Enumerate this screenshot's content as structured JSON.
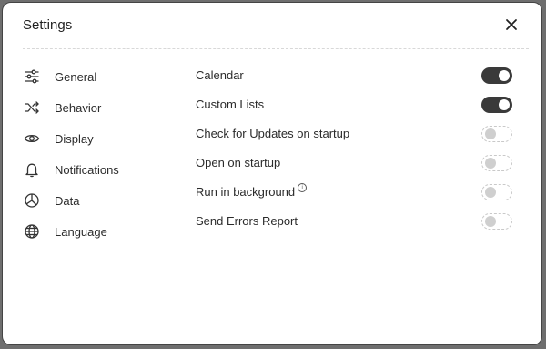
{
  "dialog": {
    "title": "Settings"
  },
  "sidebar": {
    "items": [
      {
        "label": "General",
        "icon": "sliders-icon"
      },
      {
        "label": "Behavior",
        "icon": "shuffle-icon"
      },
      {
        "label": "Display",
        "icon": "eye-icon"
      },
      {
        "label": "Notifications",
        "icon": "bell-icon"
      },
      {
        "label": "Data",
        "icon": "pie-chart-icon"
      },
      {
        "label": "Language",
        "icon": "globe-icon"
      }
    ]
  },
  "settings": {
    "rows": [
      {
        "label": "Calendar",
        "enabled": true
      },
      {
        "label": "Custom Lists",
        "enabled": true
      },
      {
        "label": "Check for Updates on startup",
        "enabled": false
      },
      {
        "label": "Open on startup",
        "enabled": false
      },
      {
        "label": "Run in background",
        "enabled": false,
        "info": true
      },
      {
        "label": "Send Errors Report",
        "enabled": false
      }
    ]
  },
  "colors": {
    "toggle_on": "#3a3a3a",
    "toggle_off_border": "#c9c9c9"
  }
}
